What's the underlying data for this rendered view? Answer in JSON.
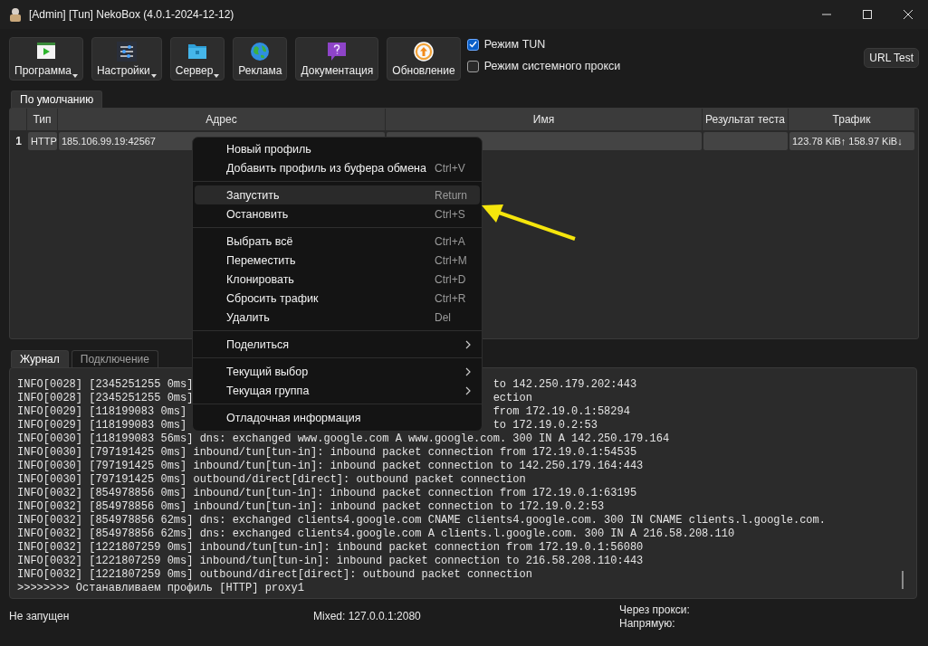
{
  "window": {
    "title": "[Admin] [Tun] NekoBox (4.0.1-2024-12-12)"
  },
  "toolbar": {
    "buttons": [
      {
        "label": "Программа",
        "kind": "play",
        "dropdown": true
      },
      {
        "label": "Настройки",
        "kind": "sliders",
        "dropdown": true
      },
      {
        "label": "Сервер",
        "kind": "folder",
        "dropdown": true
      },
      {
        "label": "Реклама",
        "kind": "globe",
        "dropdown": false
      },
      {
        "label": "Документация",
        "kind": "help",
        "dropdown": false
      },
      {
        "label": "Обновление",
        "kind": "update",
        "dropdown": false
      }
    ],
    "checkboxes": [
      {
        "label": "Режим TUN",
        "checked": true
      },
      {
        "label": "Режим системного прокси",
        "checked": false
      }
    ],
    "url_test_button": "URL Test"
  },
  "group_tabs": [
    {
      "label": "По умолчанию",
      "selected": true
    }
  ],
  "table": {
    "columns": [
      "Тип",
      "Адрес",
      "Имя",
      "Результат теста",
      "Трафик"
    ],
    "rows": [
      {
        "index": "1",
        "selected": true,
        "cells": [
          "HTTP",
          "185.106.99.19:42567",
          "",
          "",
          "123.78 KiB↑ 158.97 KiB↓"
        ]
      }
    ]
  },
  "log_tabs": [
    {
      "label": "Журнал",
      "selected": true
    },
    {
      "label": "Подключение",
      "selected": false
    }
  ],
  "log": {
    "lines": [
      {
        "text": "INFO[0028] [2345251255 0ms]",
        "tail": "to 142.250.179.202:443"
      },
      {
        "text": "INFO[0028] [2345251255 0ms]",
        "tail": "ection"
      },
      {
        "text": "INFO[0029] [118199083 0ms]",
        "tail": "from 172.19.0.1:58294"
      },
      {
        "text": "INFO[0029] [118199083 0ms]",
        "tail": "to 172.19.0.2:53"
      },
      {
        "text": "INFO[0030] [118199083 56ms] dns: exchanged www.google.com A www.google.com. 300 IN A 142.250.179.164"
      },
      {
        "text": "INFO[0030] [797191425 0ms] inbound/tun[tun-in]: inbound packet connection from 172.19.0.1:54535"
      },
      {
        "text": "INFO[0030] [797191425 0ms] inbound/tun[tun-in]: inbound packet connection to 142.250.179.164:443"
      },
      {
        "text": "INFO[0030] [797191425 0ms] outbound/direct[direct]: outbound packet connection"
      },
      {
        "text": "INFO[0032] [854978856 0ms] inbound/tun[tun-in]: inbound packet connection from 172.19.0.1:63195"
      },
      {
        "text": "INFO[0032] [854978856 0ms] inbound/tun[tun-in]: inbound packet connection to 172.19.0.2:53"
      },
      {
        "text": "INFO[0032] [854978856 62ms] dns: exchanged clients4.google.com CNAME clients4.google.com. 300 IN CNAME clients.l.google.com."
      },
      {
        "text": "INFO[0032] [854978856 62ms] dns: exchanged clients4.google.com A clients.l.google.com. 300 IN A 216.58.208.110"
      },
      {
        "text": "INFO[0032] [1221807259 0ms] inbound/tun[tun-in]: inbound packet connection from 172.19.0.1:56080"
      },
      {
        "text": "INFO[0032] [1221807259 0ms] inbound/tun[tun-in]: inbound packet connection to 216.58.208.110:443"
      },
      {
        "text": "INFO[0032] [1221807259 0ms] outbound/direct[direct]: outbound packet connection"
      },
      {
        "text": ">>>>>>>> Останавливаем профиль [HTTP] proxy1"
      }
    ]
  },
  "context_menu": {
    "items": [
      {
        "kind": "item",
        "label": "Новый профиль",
        "highlighted": false
      },
      {
        "kind": "item",
        "label": "Добавить профиль из буфера обмена",
        "shortcut": "Ctrl+V",
        "highlighted": false
      },
      {
        "kind": "separator"
      },
      {
        "kind": "item",
        "label": "Запустить",
        "shortcut": "Return",
        "highlighted": true
      },
      {
        "kind": "item",
        "label": "Остановить",
        "shortcut": "Ctrl+S",
        "highlighted": false
      },
      {
        "kind": "separator"
      },
      {
        "kind": "item",
        "label": "Выбрать всё",
        "shortcut": "Ctrl+A",
        "highlighted": false
      },
      {
        "kind": "item",
        "label": "Переместить",
        "shortcut": "Ctrl+M",
        "highlighted": false
      },
      {
        "kind": "item",
        "label": "Клонировать",
        "shortcut": "Ctrl+D",
        "highlighted": false
      },
      {
        "kind": "item",
        "label": "Сбросить трафик",
        "shortcut": "Ctrl+R",
        "highlighted": false
      },
      {
        "kind": "item",
        "label": "Удалить",
        "shortcut": "Del",
        "highlighted": false
      },
      {
        "kind": "separator"
      },
      {
        "kind": "submenu",
        "label": "Поделиться",
        "highlighted": false
      },
      {
        "kind": "separator"
      },
      {
        "kind": "submenu",
        "label": "Текущий выбор",
        "highlighted": false
      },
      {
        "kind": "submenu",
        "label": "Текущая группа",
        "highlighted": false
      },
      {
        "kind": "separator"
      },
      {
        "kind": "item",
        "label": "Отладочная информация",
        "highlighted": false
      }
    ]
  },
  "status_bar": {
    "state": "Не запущен",
    "mixed": "Mixed: 127.0.0.1:2080",
    "proxy_label": "Через прокси:",
    "direct_label": "Напрямую:"
  }
}
